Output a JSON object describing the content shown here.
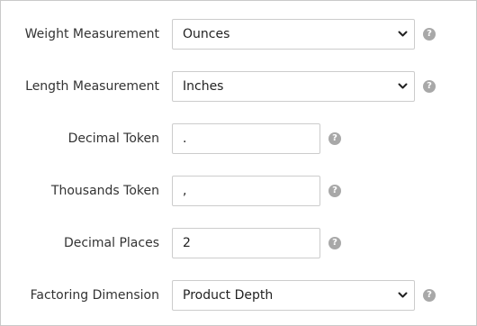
{
  "fields": [
    {
      "label": "Weight Measurement",
      "type": "select",
      "value": "Ounces"
    },
    {
      "label": "Length Measurement",
      "type": "select",
      "value": "Inches"
    },
    {
      "label": "Decimal Token",
      "type": "text",
      "value": "."
    },
    {
      "label": "Thousands Token",
      "type": "text",
      "value": ","
    },
    {
      "label": "Decimal Places",
      "type": "text",
      "value": "2"
    },
    {
      "label": "Factoring Dimension",
      "type": "select",
      "value": "Product Depth"
    }
  ],
  "icons": {
    "help": "question-circle-icon",
    "dropdown": "chevron-down-icon"
  },
  "help_glyph": "?",
  "colors": {
    "border": "#cccccc",
    "help_icon": "#a8a8a8",
    "label_text": "#333333"
  }
}
